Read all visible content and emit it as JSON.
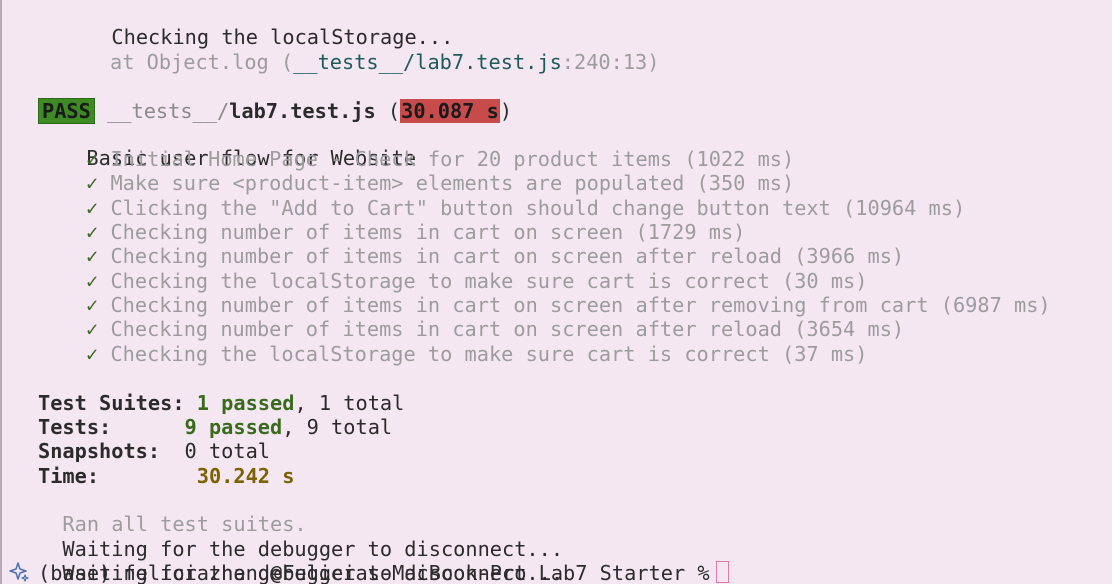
{
  "log_header": {
    "message": "Checking the localStorage...",
    "at_prefix": "at Object.log (",
    "at_file": "__tests__/lab7.test.js",
    "at_location": ":240:13)"
  },
  "result": {
    "status": "PASS",
    "file_dir": "__tests__/",
    "file_name": "lab7.test.js",
    "open_paren": " (",
    "duration": "30.087 s",
    "close_paren": ")"
  },
  "suite": {
    "name": "Basic user flow for Website",
    "check_glyph": "✓",
    "tests": [
      "Initial Home Page - Check for 20 product items (1022 ms)",
      "Make sure <product-item> elements are populated (350 ms)",
      "Clicking the \"Add to Cart\" button should change button text (10964 ms)",
      "Checking number of items in cart on screen (1729 ms)",
      "Checking number of items in cart on screen after reload (3966 ms)",
      "Checking the localStorage to make sure cart is correct (30 ms)",
      "Checking number of items in cart on screen after removing from cart (6987 ms)",
      "Checking number of items in cart on screen after reload (3654 ms)",
      "Checking the localStorage to make sure cart is correct (37 ms)"
    ]
  },
  "summary": {
    "suites_label": "Test Suites:",
    "suites_passed": "1 passed",
    "suites_total": ", 1 total",
    "tests_label": "Tests:",
    "tests_passed": "9 passed",
    "tests_total": ", 9 total",
    "snapshots_label": "Snapshots:",
    "snapshots_value": "0 total",
    "time_label": "Time:",
    "time_value": "30.242 s",
    "ran_all": "Ran all test suites."
  },
  "waiting": [
    "Waiting for the debugger to disconnect...",
    "Waiting for the debugger to disconnect..."
  ],
  "prompt": {
    "text": "(base) feliciazhang@Felicias-MacBook-Pro Lab7_Starter %",
    "icon": "sparkle-icon"
  },
  "colors": {
    "background": "#f5e7f2",
    "pass_badge": "#3d8b22",
    "duration_badge": "#c74b4b",
    "passed_text": "#3a6b1d",
    "time_text": "#7a6200"
  }
}
